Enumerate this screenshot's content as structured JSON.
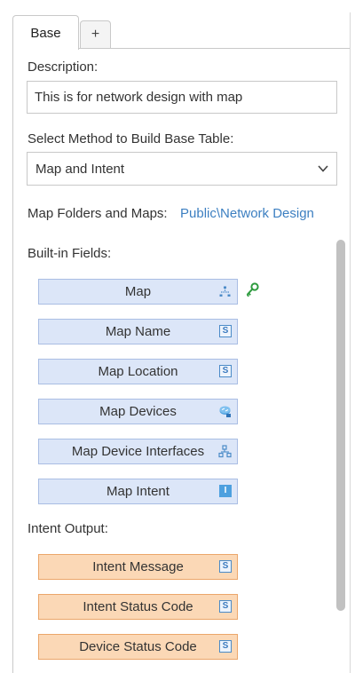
{
  "tabs": {
    "active": "Base",
    "add": "+"
  },
  "description": {
    "label": "Description:",
    "value": "This is for network design with map"
  },
  "method": {
    "label": "Select Method to Build Base Table:",
    "value": "Map and Intent"
  },
  "map_folders": {
    "label": "Map Folders and Maps:",
    "link": "Public\\Network Design"
  },
  "builtin": {
    "label": "Built-in Fields:",
    "fields": [
      {
        "label": "Map",
        "icon": "map-tree-icon"
      },
      {
        "label": "Map Name",
        "icon": "string-type-icon"
      },
      {
        "label": "Map Location",
        "icon": "string-type-icon"
      },
      {
        "label": "Map Devices",
        "icon": "device-icon"
      },
      {
        "label": "Map Device Interfaces",
        "icon": "interface-tree-icon"
      },
      {
        "label": "Map Intent",
        "icon": "intent-type-icon"
      }
    ]
  },
  "intent_output": {
    "label": "Intent Output:",
    "fields": [
      {
        "label": "Intent Message",
        "icon": "string-type-icon"
      },
      {
        "label": "Intent Status Code",
        "icon": "string-type-icon"
      },
      {
        "label": "Device Status Code",
        "icon": "string-type-icon"
      }
    ]
  },
  "icons": {
    "string_badge": "S",
    "intent_badge": "I"
  },
  "colors": {
    "blue_field": "#dce6f8",
    "orange_field": "#fbd8b6",
    "link": "#3c7fc1",
    "key": "#2e9b3f"
  }
}
